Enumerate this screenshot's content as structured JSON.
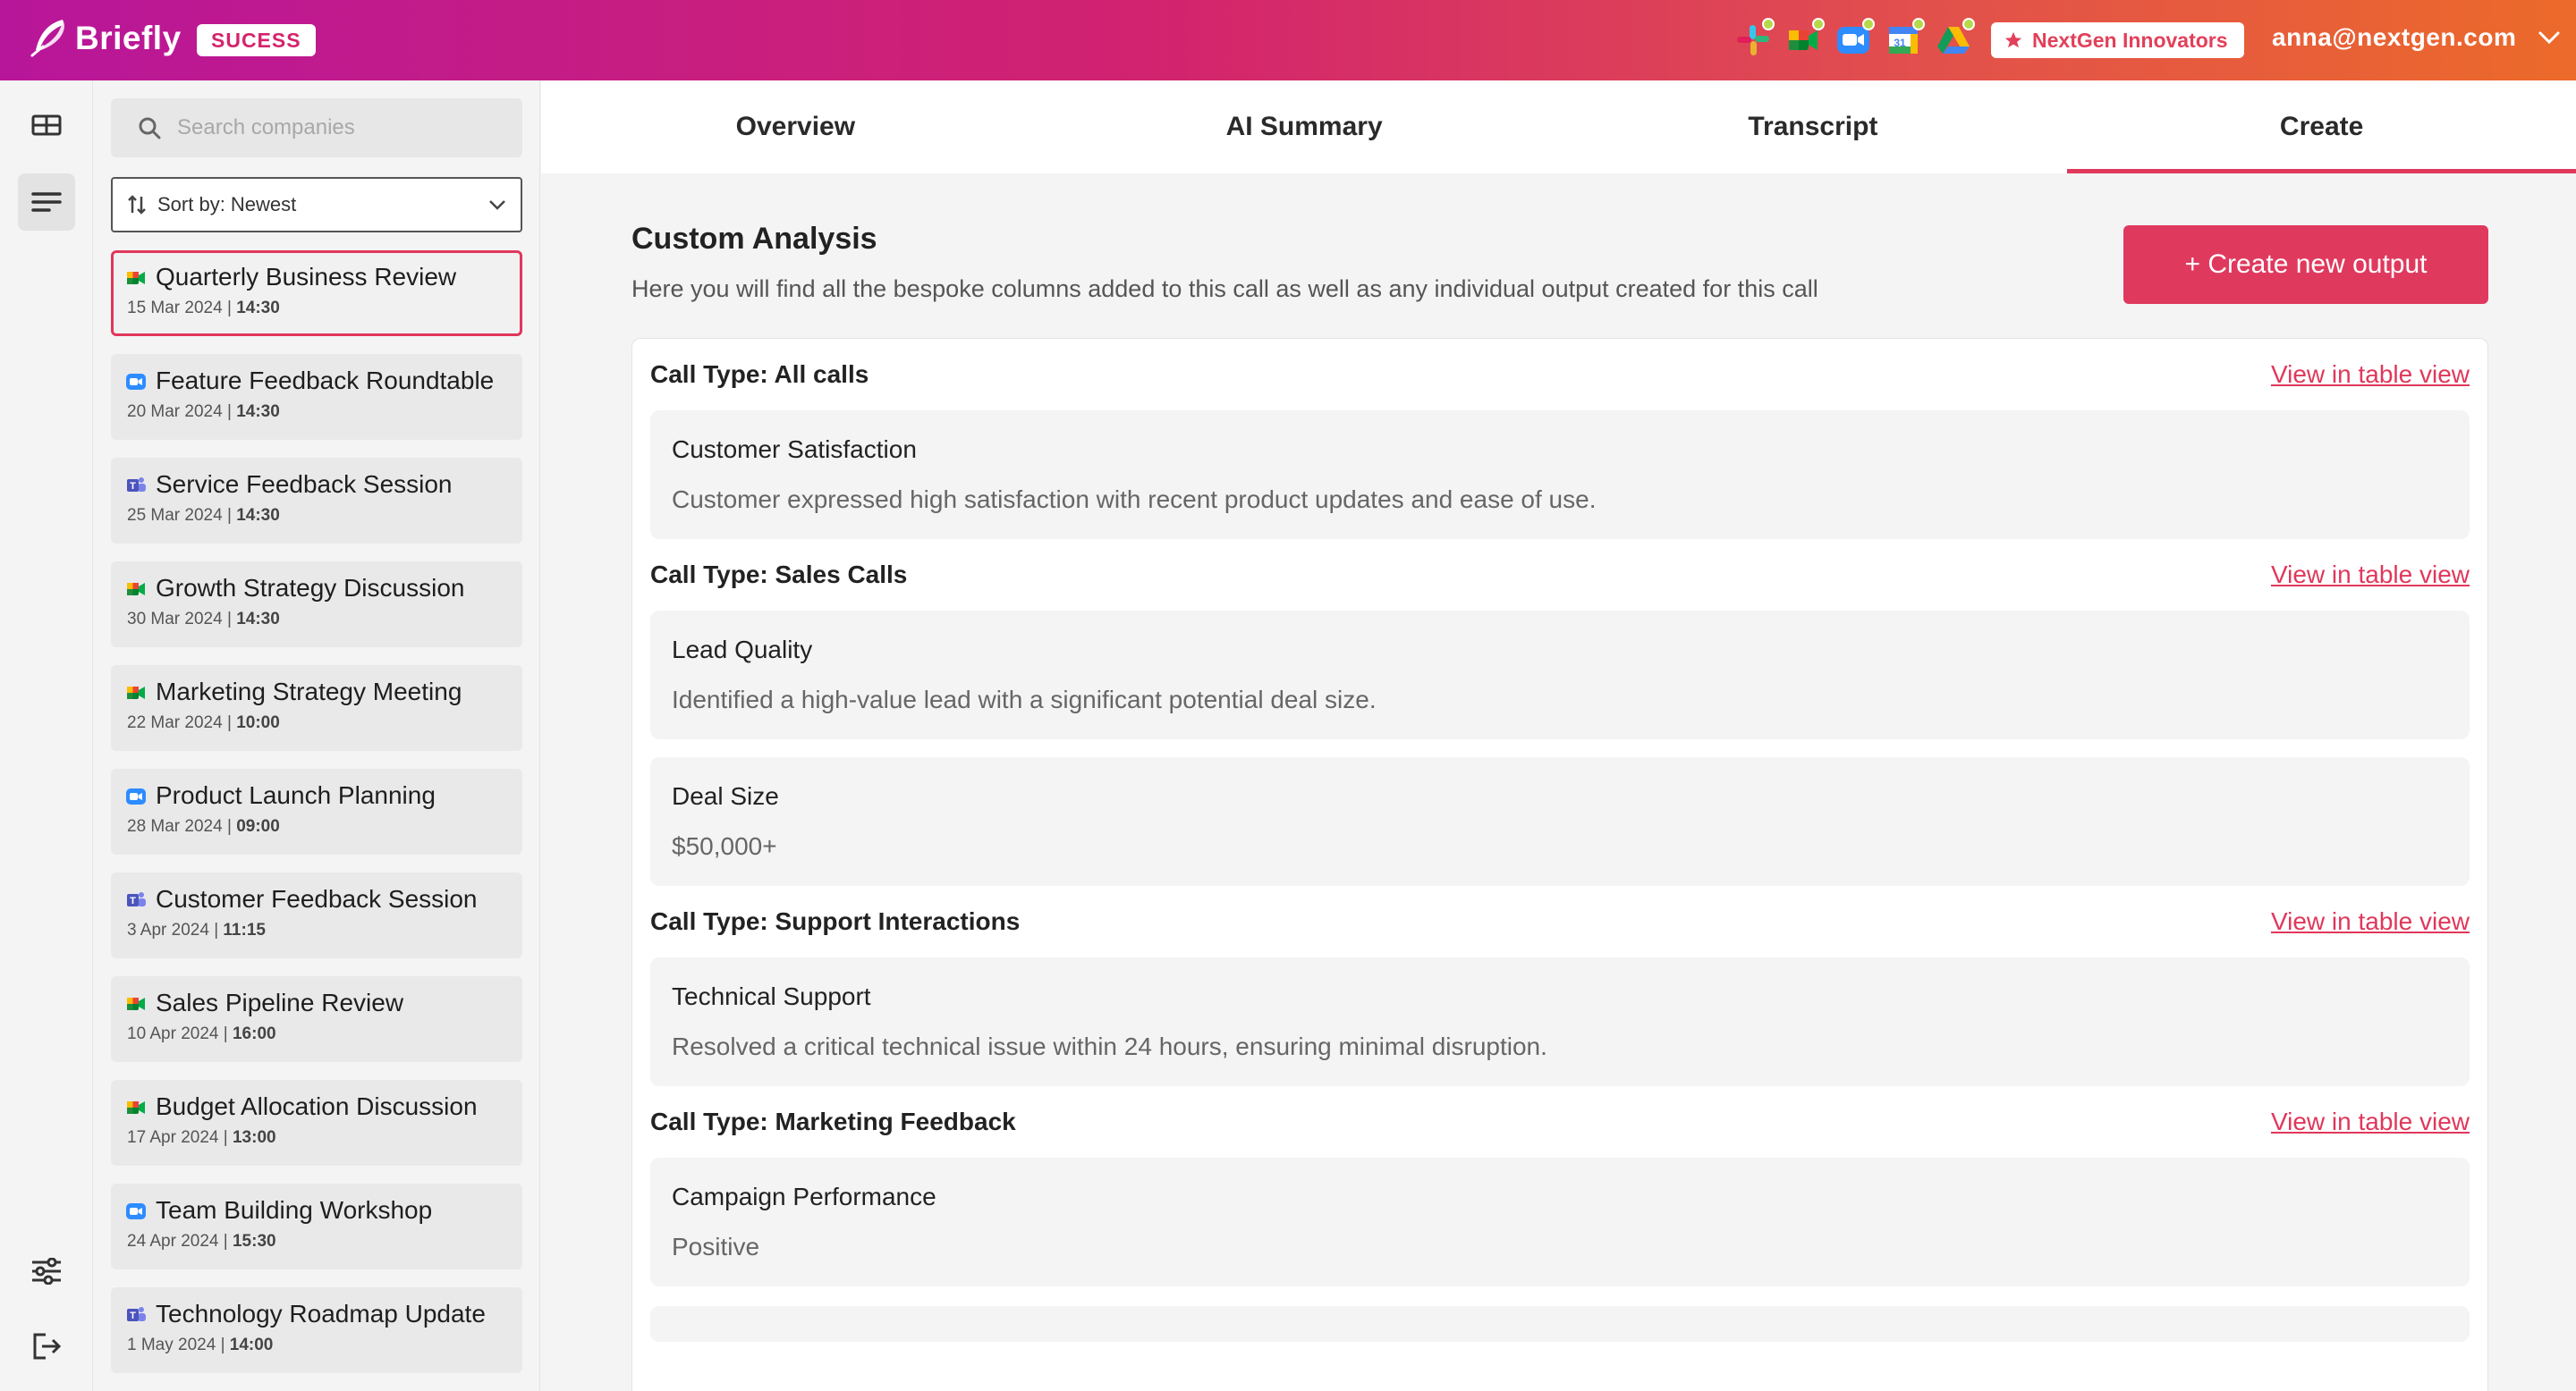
{
  "header": {
    "app_name": "Briefly",
    "status_badge": "SUCESS",
    "integrations": [
      "slack-icon",
      "google-meet-icon",
      "zoom-icon",
      "google-calendar-icon",
      "google-drive-icon"
    ],
    "org_name": "NextGen Innovators",
    "user_email": "anna@nextgen.com"
  },
  "sidebar": {
    "search_placeholder": "Search companies",
    "sort_label": "Sort by: Newest",
    "calls": [
      {
        "title": "Quarterly Business Review",
        "date": "15 Mar 2024 | ",
        "time": "14:30",
        "app": "google-meet",
        "selected": true
      },
      {
        "title": "Feature Feedback Roundtable",
        "date": "20 Mar 2024 | ",
        "time": "14:30",
        "app": "zoom"
      },
      {
        "title": "Service Feedback Session",
        "date": "25 Mar 2024 | ",
        "time": "14:30",
        "app": "teams"
      },
      {
        "title": "Growth Strategy Discussion",
        "date": "30 Mar 2024 | ",
        "time": "14:30",
        "app": "google-meet"
      },
      {
        "title": "Marketing Strategy Meeting",
        "date": "22 Mar 2024 | ",
        "time": "10:00",
        "app": "google-meet"
      },
      {
        "title": "Product Launch Planning",
        "date": "28 Mar 2024 | ",
        "time": "09:00",
        "app": "zoom"
      },
      {
        "title": "Customer Feedback Session",
        "date": "3 Apr 2024 | ",
        "time": "11:15",
        "app": "teams"
      },
      {
        "title": "Sales Pipeline Review",
        "date": "10 Apr 2024 | ",
        "time": "16:00",
        "app": "google-meet"
      },
      {
        "title": "Budget Allocation Discussion",
        "date": "17 Apr 2024 | ",
        "time": "13:00",
        "app": "google-meet"
      },
      {
        "title": "Team Building Workshop",
        "date": "24 Apr 2024 | ",
        "time": "15:30",
        "app": "zoom"
      },
      {
        "title": "Technology Roadmap Update",
        "date": "1 May 2024 | ",
        "time": "14:00",
        "app": "teams"
      }
    ]
  },
  "tabs": [
    {
      "label": "Overview"
    },
    {
      "label": "AI Summary"
    },
    {
      "label": "Transcript"
    },
    {
      "label": "Create",
      "active": true
    }
  ],
  "content": {
    "title": "Custom Analysis",
    "subtitle": "Here you will find all the bespoke columns added to this call as well as any individual output created for this call",
    "create_button": "+ Create new output",
    "view_link": "View in table view",
    "groups": [
      {
        "heading": "Call Type: All calls",
        "items": [
          {
            "name": "Customer Satisfaction",
            "value": "Customer expressed high satisfaction with recent product updates and ease of use."
          }
        ]
      },
      {
        "heading": "Call Type: Sales Calls",
        "items": [
          {
            "name": "Lead Quality",
            "value": "Identified a high-value lead with a significant potential deal size."
          },
          {
            "name": "Deal Size",
            "value": "$50,000+"
          }
        ]
      },
      {
        "heading": "Call Type: Support Interactions",
        "items": [
          {
            "name": "Technical Support",
            "value": "Resolved a critical technical issue within 24 hours, ensuring minimal disruption."
          }
        ]
      },
      {
        "heading": "Call Type: Marketing Feedback",
        "items": [
          {
            "name": "Campaign Performance",
            "value": "Positive"
          }
        ]
      }
    ]
  },
  "colors": {
    "accent": "#e0375b",
    "header_start": "#b8169a",
    "header_end": "#ec6a2a"
  }
}
